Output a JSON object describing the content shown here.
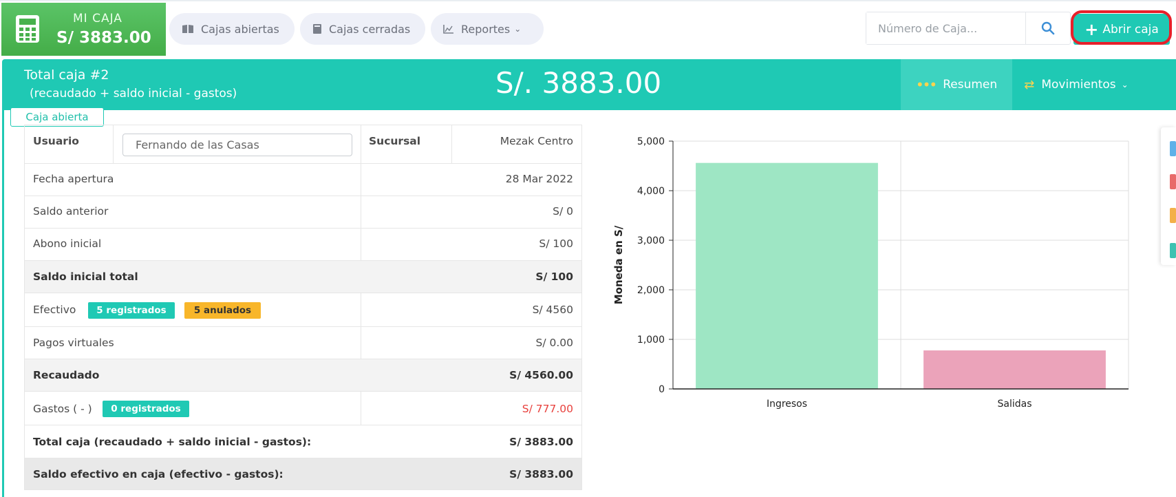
{
  "topbar": {
    "caja_title": "MI CAJA",
    "caja_amount": "S/ 3883.00",
    "nav": [
      {
        "label": "Cajas abiertas",
        "icon": "book-open-icon"
      },
      {
        "label": "Cajas cerradas",
        "icon": "book-icon"
      },
      {
        "label": "Reportes",
        "icon": "chart-icon"
      }
    ],
    "search_placeholder": "Número de Caja...",
    "abrir_label": "Abrir caja",
    "colors": {
      "green": "#4cb752",
      "teal": "#1fc9b4",
      "highlight": "#e8202a"
    }
  },
  "header": {
    "title": "Total caja #2",
    "subtitle": "(recaudado + saldo inicial - gastos)",
    "amount": "S/. 3883.00",
    "tab_resumen": "Resumen",
    "tab_movimientos": "Movimientos"
  },
  "status_badge": "Caja abierta",
  "table": {
    "usuario_label": "Usuario",
    "usuario_value": "Fernando de las Casas",
    "sucursal_label": "Sucursal",
    "sucursal_value": "Mezak Centro",
    "rows": [
      {
        "label": "Fecha apertura",
        "value": "28 Mar 2022"
      },
      {
        "label": "Saldo anterior",
        "value": "S/ 0"
      },
      {
        "label": "Abono inicial",
        "value": "S/ 100"
      },
      {
        "label": "Saldo inicial total",
        "value": "S/ 100"
      },
      {
        "label": "Efectivo",
        "value": "S/ 4560",
        "badge1": "5 registrados",
        "badge2": "5 anulados"
      },
      {
        "label": "Pagos virtuales",
        "value": "S/ 0.00"
      },
      {
        "label": "Recaudado",
        "value": "S/ 4560.00"
      },
      {
        "label": "Gastos ( - )",
        "value": "S/ 777.00",
        "badge1": "0 registrados"
      },
      {
        "label": "Total caja (recaudado + saldo inicial - gastos):",
        "value": "S/ 3883.00"
      },
      {
        "label": "Saldo efectivo en caja (efectivo - gastos):",
        "value": "S/ 3883.00"
      }
    ]
  },
  "chart_data": {
    "type": "bar",
    "categories": [
      "Ingresos",
      "Salidas"
    ],
    "values": [
      4560,
      777
    ],
    "colors": [
      "#9ee6c4",
      "#eba3ba"
    ],
    "ylabel": "Moneda en S/",
    "xlabel": "",
    "ylim": [
      0,
      5000
    ],
    "yticks": [
      "0",
      "1,000",
      "2,000",
      "3,000",
      "4,000",
      "5,000"
    ],
    "grid": true
  }
}
